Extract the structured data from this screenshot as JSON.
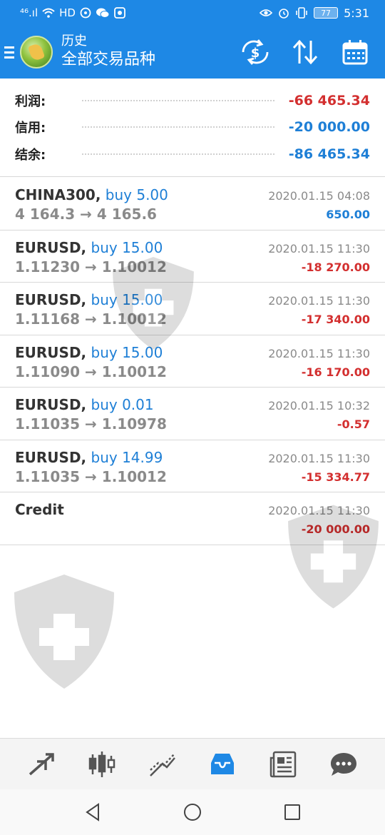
{
  "status_bar": {
    "left_text": "⁴⁶.ıl",
    "hd": "HD",
    "battery": "77",
    "time": "5:31"
  },
  "header": {
    "title": "历史",
    "subtitle": "全部交易品种",
    "bg_color": "#1e88e5"
  },
  "summary": [
    {
      "label": "利润:",
      "value": "-66 465.34",
      "color": "red"
    },
    {
      "label": "信用:",
      "value": "-20 000.00",
      "color": "blue"
    },
    {
      "label": "结余:",
      "value": "-86 465.34",
      "color": "blue"
    }
  ],
  "trades": [
    {
      "symbol": "CHINA300,",
      "type": "buy 5.00",
      "prices": "4 164.3 → 4 165.6",
      "time": "2020.01.15 04:08",
      "profit": "650.00",
      "profit_color": "blue"
    },
    {
      "symbol": "EURUSD,",
      "type": "buy 15.00",
      "prices": "1.11230 → 1.10012",
      "time": "2020.01.15 11:30",
      "profit": "-18 270.00",
      "profit_color": "red"
    },
    {
      "symbol": "EURUSD,",
      "type": "buy 15.00",
      "prices": "1.11168 → 1.10012",
      "time": "2020.01.15 11:30",
      "profit": "-17 340.00",
      "profit_color": "red"
    },
    {
      "symbol": "EURUSD,",
      "type": "buy 15.00",
      "prices": "1.11090 → 1.10012",
      "time": "2020.01.15 11:30",
      "profit": "-16 170.00",
      "profit_color": "red"
    },
    {
      "symbol": "EURUSD,",
      "type": "buy 0.01",
      "prices": "1.11035 → 1.10978",
      "time": "2020.01.15 10:32",
      "profit": "-0.57",
      "profit_color": "red"
    },
    {
      "symbol": "EURUSD,",
      "type": "buy 14.99",
      "prices": "1.11035 → 1.10012",
      "time": "2020.01.15 11:30",
      "profit": "-15 334.77",
      "profit_color": "red"
    },
    {
      "symbol": "Credit",
      "type": "",
      "prices": "",
      "time": "2020.01.15 11:30",
      "profit": "-20 000.00",
      "profit_color": "red"
    }
  ],
  "tabs": [
    {
      "name": "tab-trade",
      "icon": "trade-arrows-icon"
    },
    {
      "name": "tab-chart",
      "icon": "candlestick-icon"
    },
    {
      "name": "tab-analytics",
      "icon": "trend-lines-icon"
    },
    {
      "name": "tab-history",
      "icon": "inbox-tray-icon",
      "active": true
    },
    {
      "name": "tab-news",
      "icon": "newspaper-icon"
    },
    {
      "name": "tab-chat",
      "icon": "chat-bubble-icon"
    }
  ],
  "colors": {
    "accent": "#1e88e5",
    "profit_red": "#d32f2f",
    "profit_blue": "#1e7fd6",
    "icon_gray": "#555555"
  }
}
